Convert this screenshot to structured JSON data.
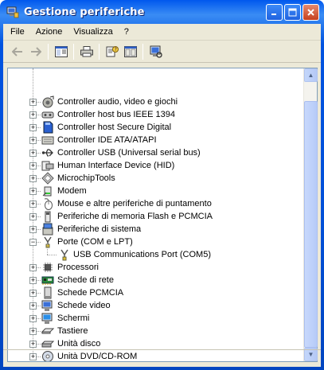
{
  "window": {
    "title": "Gestione periferiche",
    "title_icon": "computer-manage-icon",
    "buttons": [
      "minimize",
      "maximize",
      "close"
    ]
  },
  "menu": [
    "File",
    "Azione",
    "Visualizza",
    "?"
  ],
  "toolbar": {
    "icons": [
      "back-arrow-icon",
      "forward-arrow-icon",
      "show-hide-tree-icon",
      "print-icon",
      "properties-icon",
      "help-icon",
      "scan-hardware-icon"
    ]
  },
  "tree": {
    "items": [
      {
        "label": "Controller audio, video e giochi",
        "icon": "audio-icon",
        "expander": "+"
      },
      {
        "label": "Controller host bus IEEE 1394",
        "icon": "ieee1394-icon",
        "expander": "+"
      },
      {
        "label": "Controller host Secure Digital",
        "icon": "sd-controller-icon",
        "expander": "+"
      },
      {
        "label": "Controller IDE ATA/ATAPI",
        "icon": "ide-icon",
        "expander": "+"
      },
      {
        "label": "Controller USB (Universal serial bus)",
        "icon": "usb-icon",
        "expander": "+"
      },
      {
        "label": "Human Interface Device (HID)",
        "icon": "hid-icon",
        "expander": "+"
      },
      {
        "label": "MicrochipTools",
        "icon": "chip-icon",
        "expander": "+"
      },
      {
        "label": "Modem",
        "icon": "modem-icon",
        "expander": "+"
      },
      {
        "label": "Mouse e altre periferiche di puntamento",
        "icon": "mouse-icon",
        "expander": "+"
      },
      {
        "label": "Periferiche di memoria Flash e PCMCIA",
        "icon": "flash-memory-icon",
        "expander": "+"
      },
      {
        "label": "Periferiche di sistema",
        "icon": "system-device-icon",
        "expander": "+"
      },
      {
        "label": "Porte (COM e LPT)",
        "icon": "port-icon",
        "expander": "−"
      },
      {
        "label": "USB Communications Port (COM5)",
        "icon": "port-icon",
        "expander": "",
        "child": true
      },
      {
        "label": "Processori",
        "icon": "processor-icon",
        "expander": "+"
      },
      {
        "label": "Schede di rete",
        "icon": "network-card-icon",
        "expander": "+"
      },
      {
        "label": "Schede PCMCIA",
        "icon": "pcmcia-icon",
        "expander": "+"
      },
      {
        "label": "Schede video",
        "icon": "display-adapter-icon",
        "expander": "+"
      },
      {
        "label": "Schermi",
        "icon": "monitor-icon",
        "expander": "+"
      },
      {
        "label": "Tastiere",
        "icon": "keyboard-icon",
        "expander": "+"
      },
      {
        "label": "Unità disco",
        "icon": "disk-drive-icon",
        "expander": "+"
      },
      {
        "label": "Unità DVD/CD-ROM",
        "icon": "dvd-icon",
        "expander": "+"
      }
    ]
  },
  "scrollbar": {
    "up_glyph": "▲",
    "down_glyph": "▼",
    "scroll_fraction": 1.0
  }
}
